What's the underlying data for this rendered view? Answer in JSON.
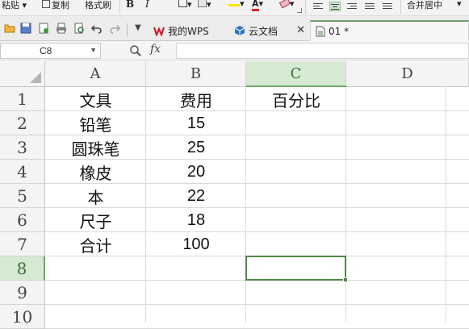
{
  "ribbon": {
    "paste_label": "粘贴",
    "copy_label": "复制",
    "format_painter_label": "格式刷",
    "bold_label": "B",
    "italic_label": "I",
    "font_color_label": "A",
    "merge_label": "合并居中"
  },
  "tabs": [
    {
      "label": "我的WPS",
      "icon": "wps-logo-icon"
    },
    {
      "label": "云文档",
      "icon": "cloud-doc-icon"
    },
    {
      "label": "01 *",
      "icon": "sheet-doc-icon"
    }
  ],
  "formula_bar": {
    "cell_ref": "C8",
    "fx_label": "fx",
    "value": ""
  },
  "sheet": {
    "columns": [
      "A",
      "B",
      "C",
      "D"
    ],
    "rows": [
      "1",
      "2",
      "3",
      "4",
      "5",
      "6",
      "7",
      "8",
      "9",
      "10"
    ],
    "selected_cell": "C8",
    "cells": {
      "A1": "文具",
      "B1": "费用",
      "C1": "百分比",
      "A2": "铅笔",
      "B2": "15",
      "A3": "圆珠笔",
      "B3": "25",
      "A4": "橡皮",
      "B4": "20",
      "A5": "本",
      "B5": "22",
      "A6": "尺子",
      "B6": "18",
      "A7": "合计",
      "B7": "100"
    }
  },
  "colors": {
    "accent_green": "#4d8a43",
    "selected_header_bg": "#d6e9d2",
    "wps_red": "#d0202a"
  }
}
